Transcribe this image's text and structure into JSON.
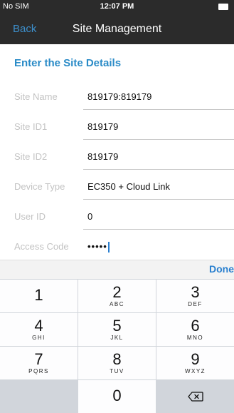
{
  "status_bar": {
    "carrier": "No SIM",
    "time": "12:07 PM"
  },
  "nav": {
    "back_label": "Back",
    "title": "Site Management"
  },
  "form": {
    "header": "Enter the Site Details",
    "fields": [
      {
        "label": "Site Name",
        "value": "819179:819179"
      },
      {
        "label": "Site ID1",
        "value": "819179"
      },
      {
        "label": "Site ID2",
        "value": "819179"
      },
      {
        "label": "Device Type",
        "value": "EC350 + Cloud Link"
      },
      {
        "label": "User ID",
        "value": "0"
      },
      {
        "label": "Access Code",
        "value": "•••••"
      }
    ]
  },
  "accessory": {
    "done_label": "Done"
  },
  "keypad": {
    "keys": [
      {
        "digit": "1",
        "letters": ""
      },
      {
        "digit": "2",
        "letters": "ABC"
      },
      {
        "digit": "3",
        "letters": "DEF"
      },
      {
        "digit": "4",
        "letters": "GHI"
      },
      {
        "digit": "5",
        "letters": "JKL"
      },
      {
        "digit": "6",
        "letters": "MNO"
      },
      {
        "digit": "7",
        "letters": "PQRS"
      },
      {
        "digit": "8",
        "letters": "TUV"
      },
      {
        "digit": "9",
        "letters": "WXYZ"
      },
      {
        "digit": "0",
        "letters": ""
      }
    ]
  },
  "colors": {
    "accent": "#2a8bc7",
    "nav_bg": "#2b2b2b",
    "keypad_bg": "#d1d5db"
  },
  "icons": {
    "battery": "battery-icon",
    "backspace": "backspace-icon"
  }
}
